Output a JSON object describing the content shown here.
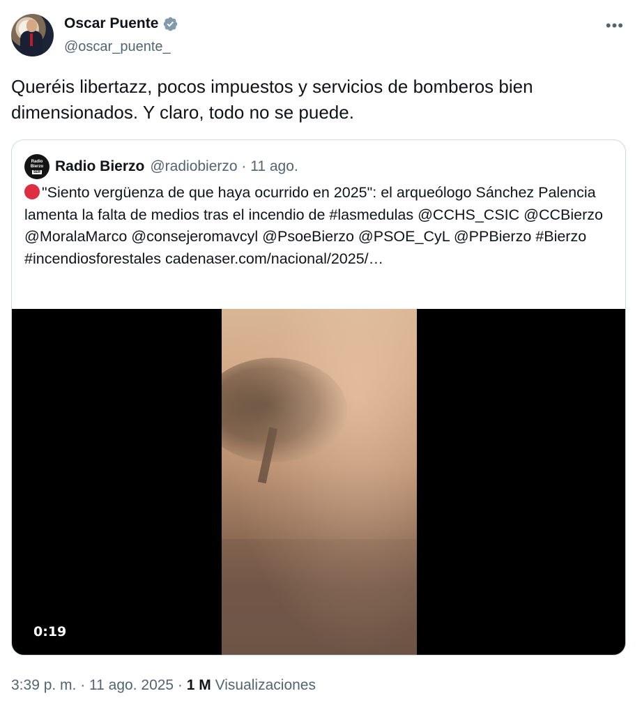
{
  "author": {
    "display_name": "Oscar Puente",
    "handle": "@oscar_puente_",
    "verified_icon": "verified-badge-icon"
  },
  "more_label": "•••",
  "tweet_text": "Queréis libertazz, pocos impuestos y servicios de bomberos bien dimensionados. Y claro, todo no se puede.",
  "quote": {
    "avatar_text": [
      "Radio",
      "Bierzo",
      "SER"
    ],
    "display_name": "Radio Bierzo",
    "meta": "@radiobierzo · 11 ago.",
    "text": "\"Siento vergüenza de que haya ocurrido en 2025\": el arqueólogo Sánchez Palencia lamenta la falta de medios tras el incendio de #lasmedulas @CCHS_CSIC @CCBierzo @MoralaMarco @consejeromavcyl @PsoeBierzo @PSOE_CyL @PPBierzo #Bierzo #incendiosforestales cadenaser.com/nacional/2025/…",
    "video": {
      "timecode": "0:19"
    }
  },
  "footer": {
    "timestamp": "3:39 p. m. · 11 ago. 2025 · ",
    "views_count": "1 M",
    "views_label": " Visualizaciones"
  },
  "colors": {
    "text_primary": "#0f1419",
    "text_secondary": "#536471",
    "verified_blue": "#829aab",
    "border": "#cfd9de",
    "red_circle": "#dd2e44"
  }
}
